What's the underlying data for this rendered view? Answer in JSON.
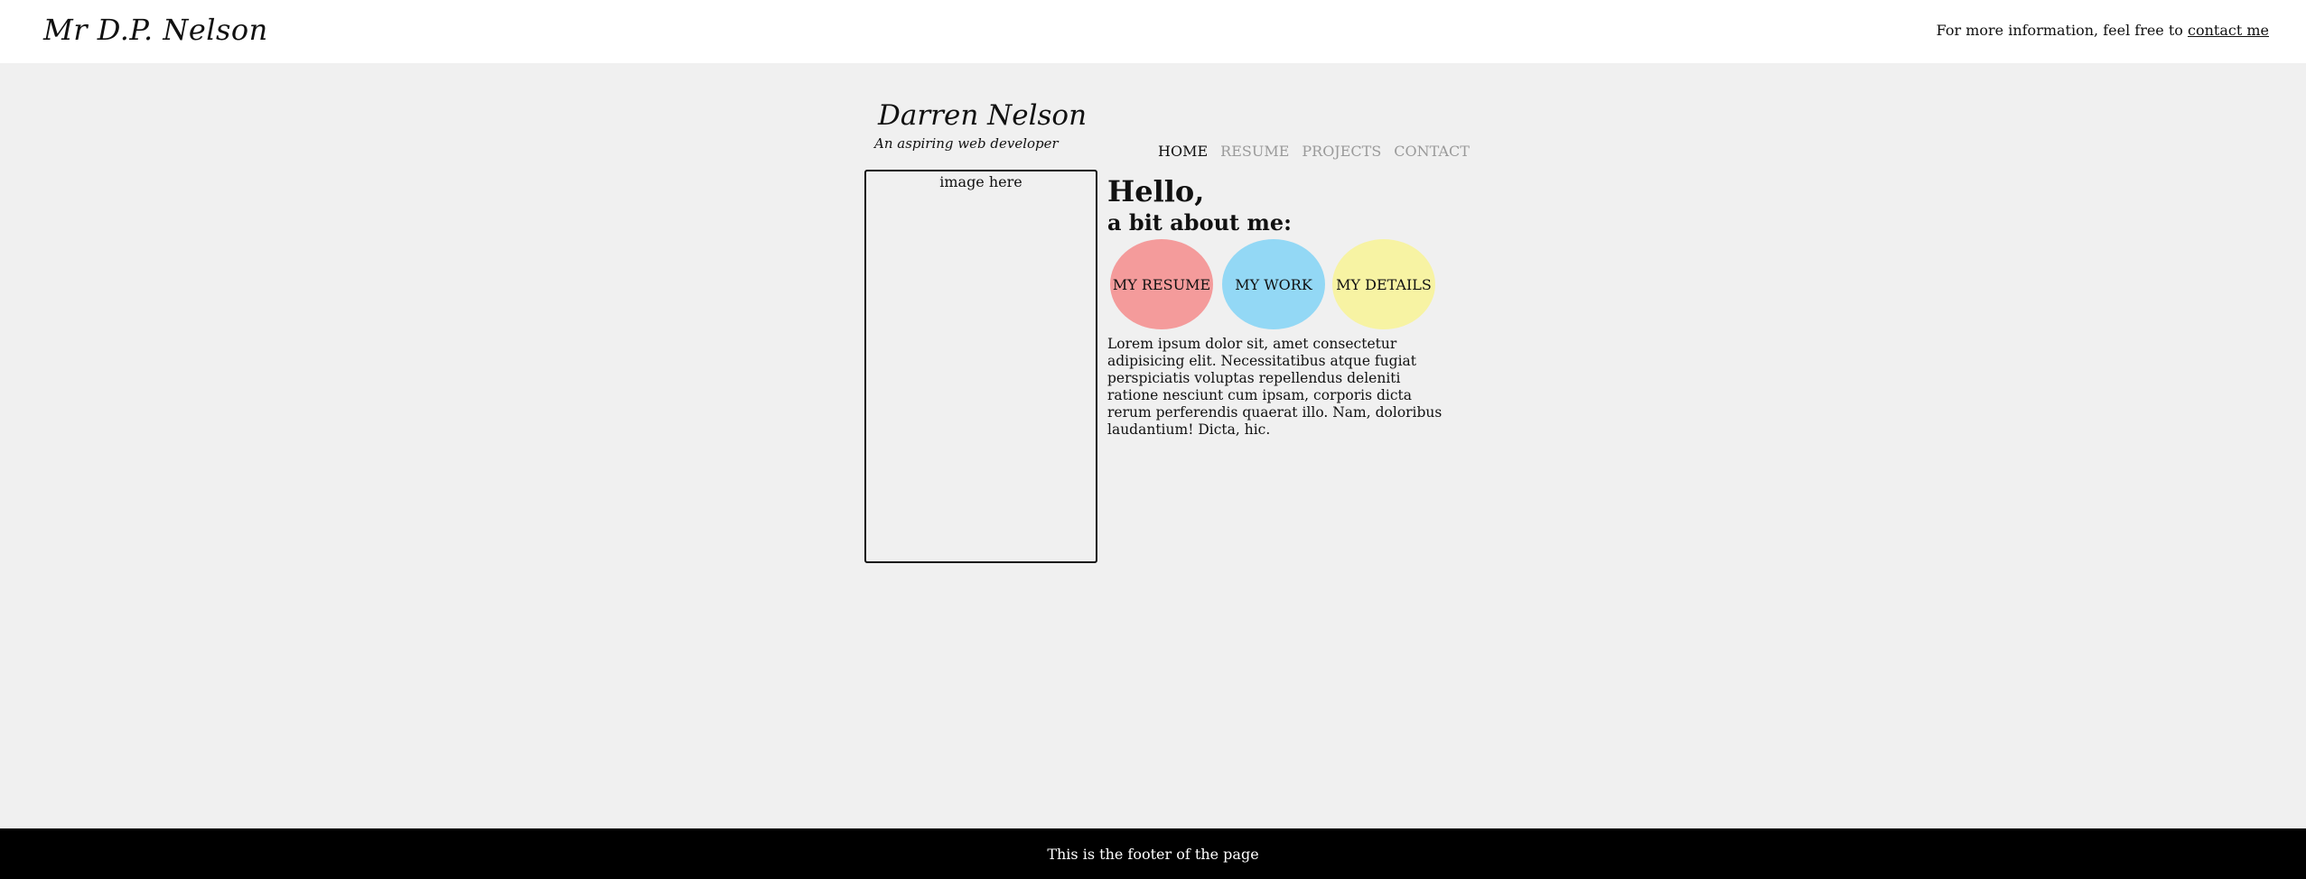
{
  "header": {
    "brand": "Mr D.P. Nelson",
    "info_text": "For more information, feel free to ",
    "contact_link": "contact me"
  },
  "site": {
    "name": "Darren Nelson",
    "tagline": "An aspiring web developer"
  },
  "nav": {
    "items": [
      {
        "label": "HOME",
        "active": true
      },
      {
        "label": "RESUME",
        "active": false
      },
      {
        "label": "PROJECTS",
        "active": false
      },
      {
        "label": "CONTACT",
        "active": false
      }
    ]
  },
  "image_placeholder": "image here",
  "intro": {
    "greeting": "Hello,",
    "subheading": "a bit about me:",
    "buttons": [
      {
        "label": "MY RESUME",
        "color": "#f49b9b"
      },
      {
        "label": "MY WORK",
        "color": "#93d8f5"
      },
      {
        "label": "MY DETAILS",
        "color": "#f7f3a3"
      }
    ],
    "paragraph": "Lorem ipsum dolor sit, amet consectetur adipisicing elit. Necessitatibus atque fugiat perspiciatis voluptas repellendus deleniti ratione nesciunt cum ipsam, corporis dicta rerum perferendis quaerat illo. Nam, doloribus laudantium! Dicta, hic."
  },
  "footer": {
    "text": "This is the footer of the page"
  }
}
